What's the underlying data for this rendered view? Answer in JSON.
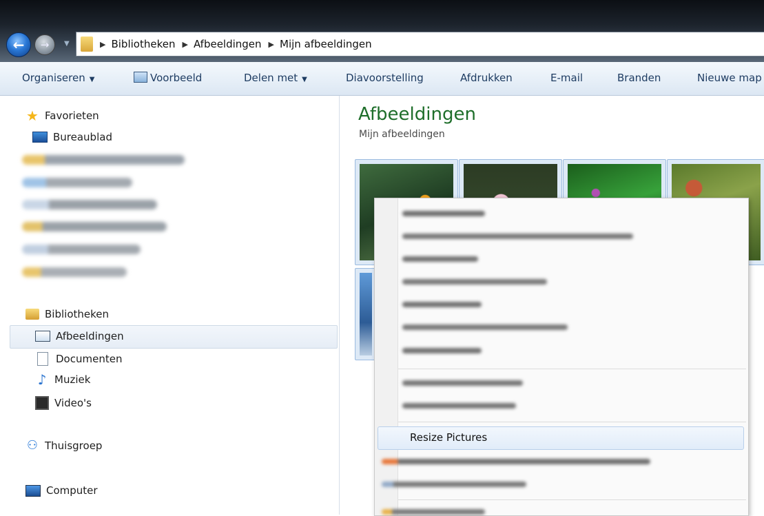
{
  "breadcrumb": [
    "Bibliotheken",
    "Afbeeldingen",
    "Mijn afbeeldingen"
  ],
  "toolbar": {
    "organize": "Organiseren",
    "preview": "Voorbeeld",
    "share": "Delen met",
    "slideshow": "Diavoorstelling",
    "print": "Afdrukken",
    "email": "E-mail",
    "burn": "Branden",
    "new_folder": "Nieuwe map"
  },
  "nav": {
    "favorites": "Favorieten",
    "desktop": "Bureaublad",
    "libraries": "Bibliotheken",
    "pictures": "Afbeeldingen",
    "documents": "Documenten",
    "music": "Muziek",
    "videos": "Video's",
    "homegroup": "Thuisgroep",
    "computer": "Computer"
  },
  "content": {
    "title": "Afbeeldingen",
    "subtitle": "Mijn afbeeldingen"
  },
  "context_menu": {
    "highlighted_item": "Resize Pictures"
  }
}
